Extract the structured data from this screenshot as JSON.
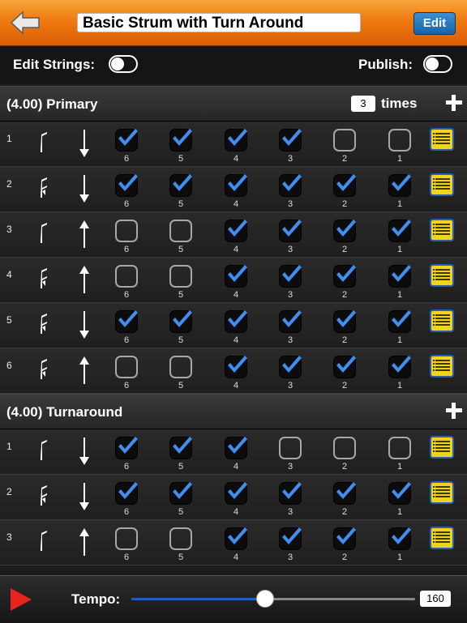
{
  "header": {
    "title": "Basic Strum with Turn Around",
    "edit_label": "Edit",
    "back_icon": "back-arrow-icon"
  },
  "options": {
    "edit_strings_label": "Edit Strings:",
    "edit_strings_on": false,
    "publish_label": "Publish:",
    "publish_on": false
  },
  "string_labels": [
    "6",
    "5",
    "4",
    "3",
    "2",
    "1"
  ],
  "sections": [
    {
      "title": "(4.00) Primary",
      "repeat_count": "3",
      "repeat_label": "times",
      "rows": [
        {
          "num": "1",
          "note": "quarter",
          "direction": "down",
          "strings": [
            true,
            true,
            true,
            true,
            false,
            false
          ]
        },
        {
          "num": "2",
          "note": "eighth",
          "direction": "down",
          "strings": [
            true,
            true,
            true,
            true,
            true,
            true
          ]
        },
        {
          "num": "3",
          "note": "quarter",
          "direction": "up",
          "strings": [
            false,
            false,
            true,
            true,
            true,
            true
          ]
        },
        {
          "num": "4",
          "note": "eighth",
          "direction": "up",
          "strings": [
            false,
            false,
            true,
            true,
            true,
            true
          ]
        },
        {
          "num": "5",
          "note": "eighth",
          "direction": "down",
          "strings": [
            true,
            true,
            true,
            true,
            true,
            true
          ]
        },
        {
          "num": "6",
          "note": "eighth",
          "direction": "up",
          "strings": [
            false,
            false,
            true,
            true,
            true,
            true
          ]
        }
      ]
    },
    {
      "title": "(4.00) Turnaround",
      "rows": [
        {
          "num": "1",
          "note": "quarter",
          "direction": "down",
          "strings": [
            true,
            true,
            true,
            false,
            false,
            false
          ]
        },
        {
          "num": "2",
          "note": "eighth",
          "direction": "down",
          "strings": [
            true,
            true,
            true,
            true,
            true,
            true
          ]
        },
        {
          "num": "3",
          "note": "quarter",
          "direction": "up",
          "strings": [
            false,
            false,
            true,
            true,
            true,
            true
          ]
        }
      ]
    }
  ],
  "footer": {
    "tempo_label": "Tempo:",
    "tempo_value": "160",
    "tempo_fraction": 0.47
  },
  "colors": {
    "accent_orange": "#ef7a10",
    "check_blue": "#3f8ef0",
    "list_yellow": "#f2d21a",
    "play_red": "#e8231b"
  }
}
